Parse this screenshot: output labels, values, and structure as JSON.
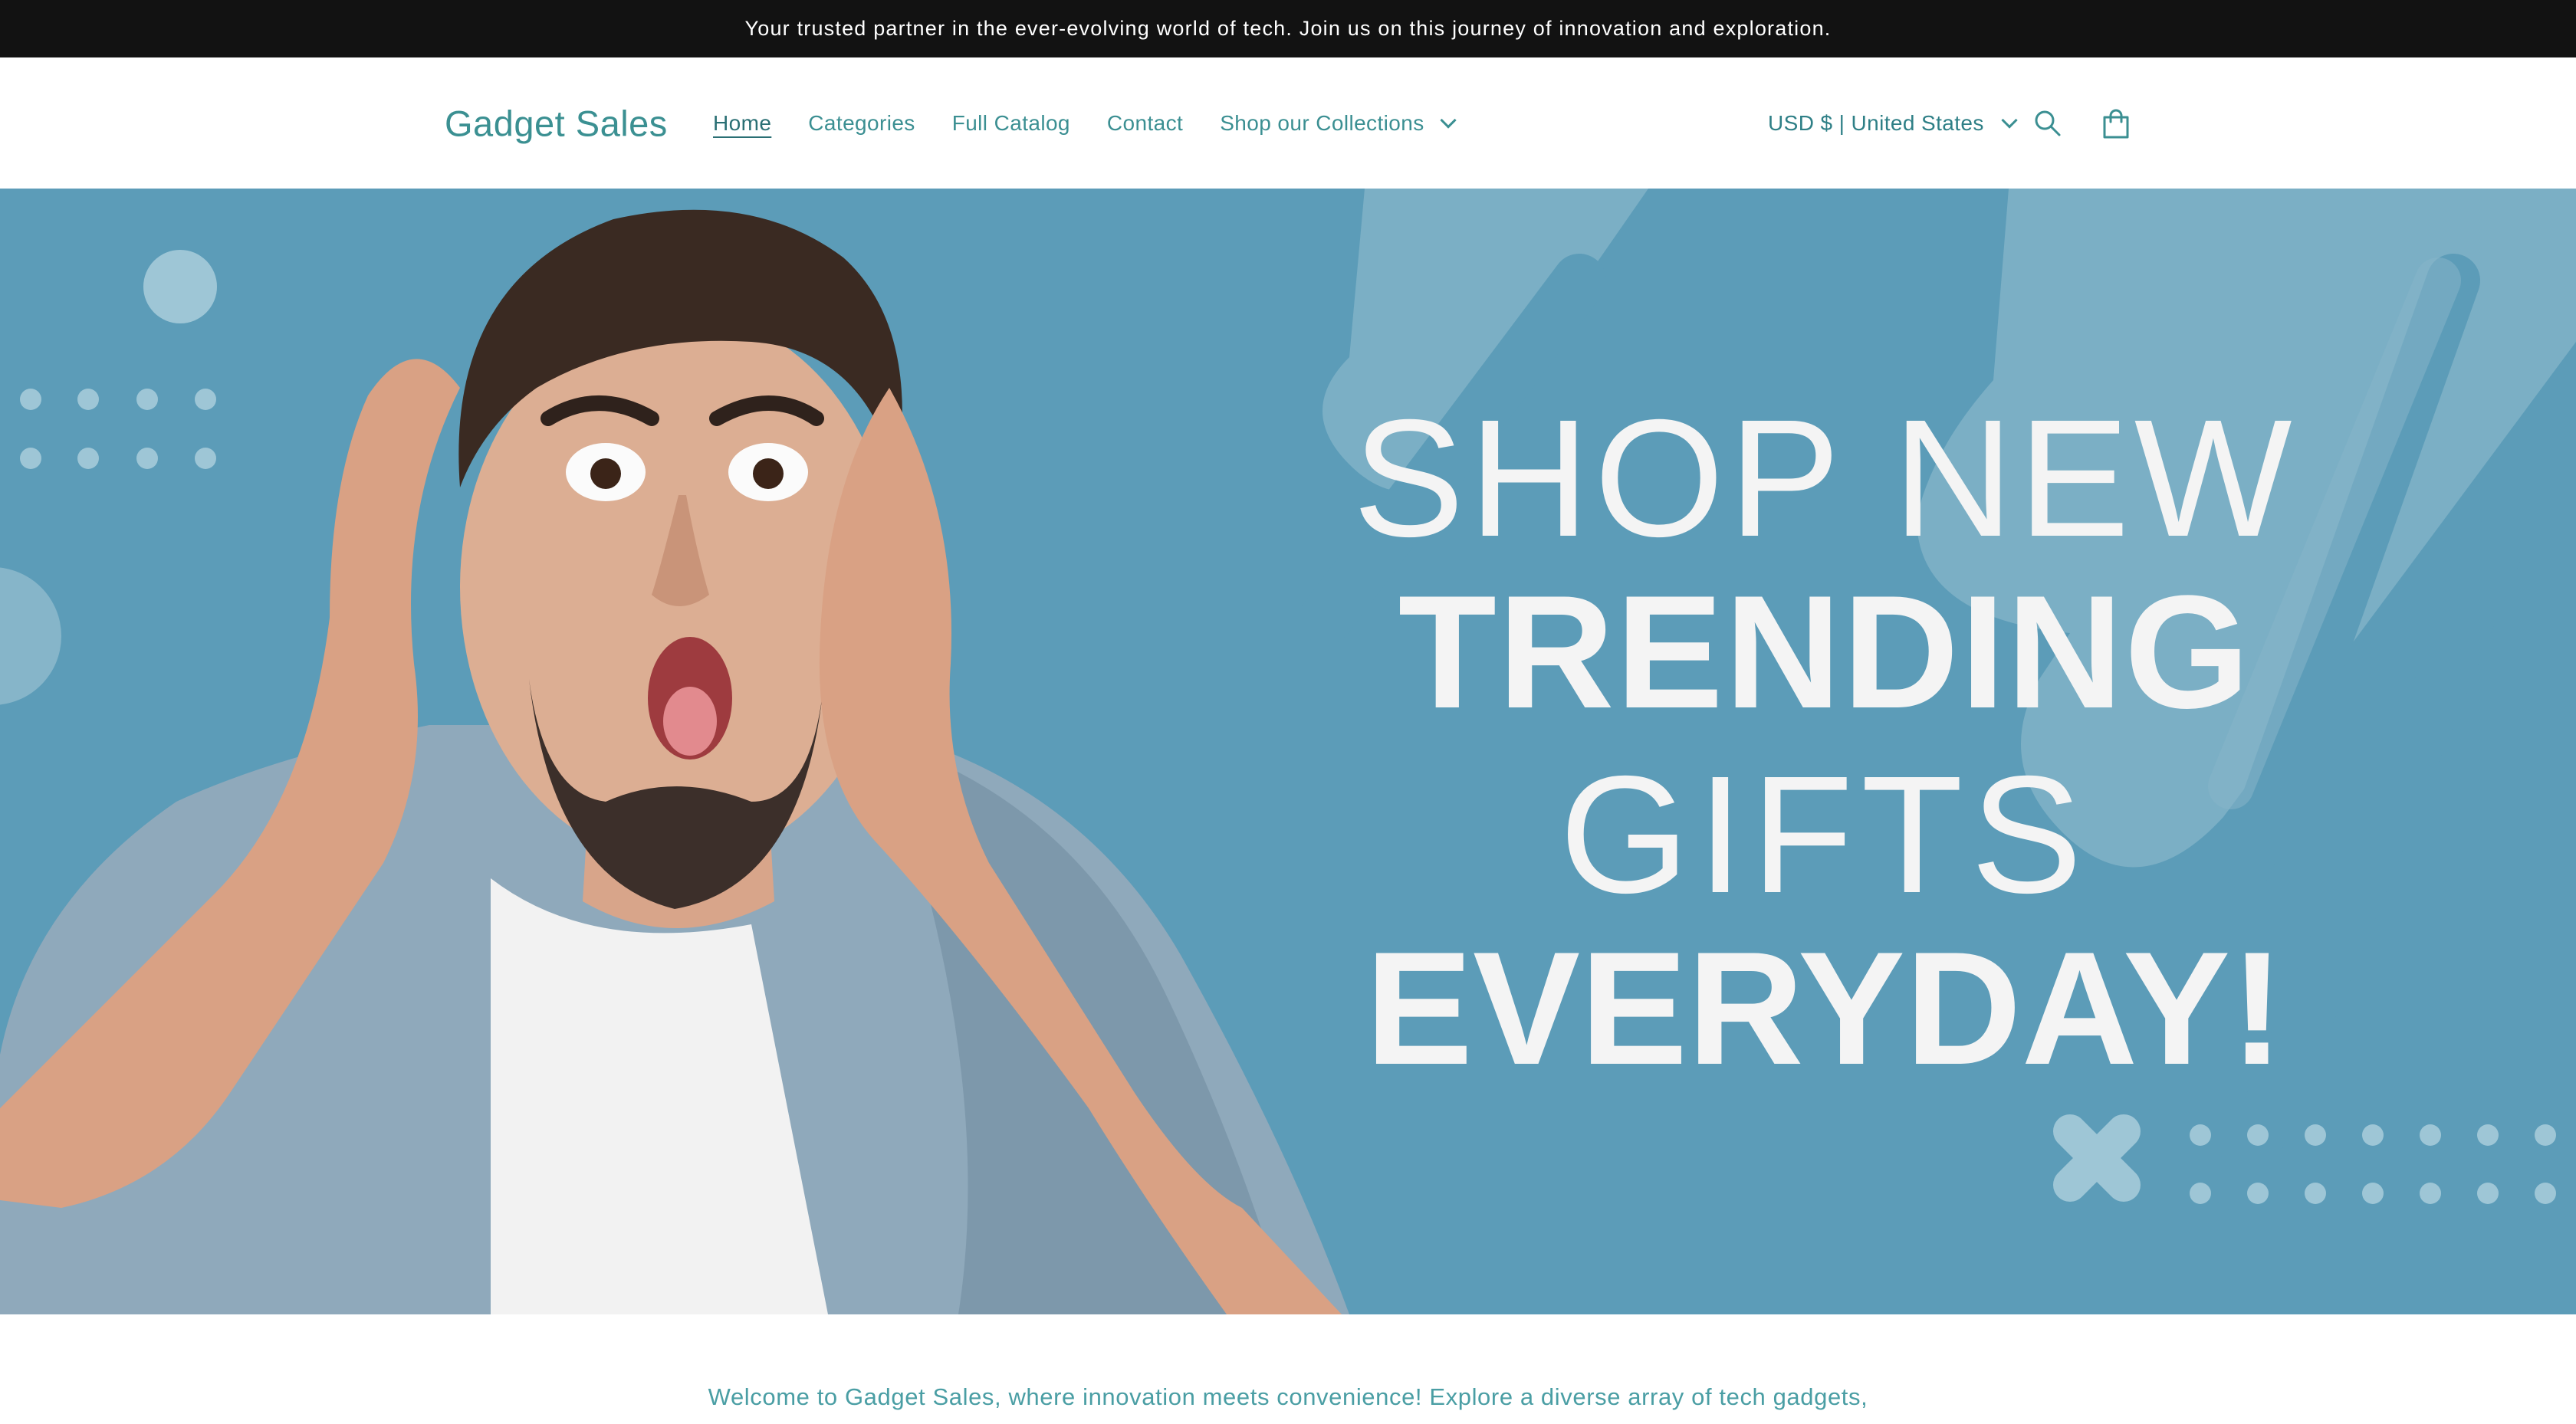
{
  "announcement": {
    "text": "Your trusted partner in the ever-evolving world of tech. Join us on this journey of innovation and exploration."
  },
  "header": {
    "logo": "Gadget Sales",
    "nav": [
      {
        "label": "Home",
        "active": true
      },
      {
        "label": "Categories"
      },
      {
        "label": "Full Catalog"
      },
      {
        "label": "Contact"
      },
      {
        "label": "Shop our Collections",
        "has_dropdown": true
      }
    ],
    "currency": "USD $ | United States",
    "icons": {
      "search": "search-icon",
      "cart": "cart-icon",
      "dropdown": "chevron-down-icon"
    }
  },
  "hero": {
    "line1": "SHOP NEW",
    "line2": "TRENDING",
    "line3": "GIFTS",
    "line4": "EVERYDAY!",
    "colors": {
      "background": "#5c9cb8",
      "text": "#f4f4f4"
    }
  },
  "intro": {
    "text": "Welcome to Gadget Sales, where innovation meets convenience! Explore a diverse array of tech gadgets,"
  },
  "colors": {
    "accent": "#3b8f92",
    "announcement_bg": "#121212"
  }
}
